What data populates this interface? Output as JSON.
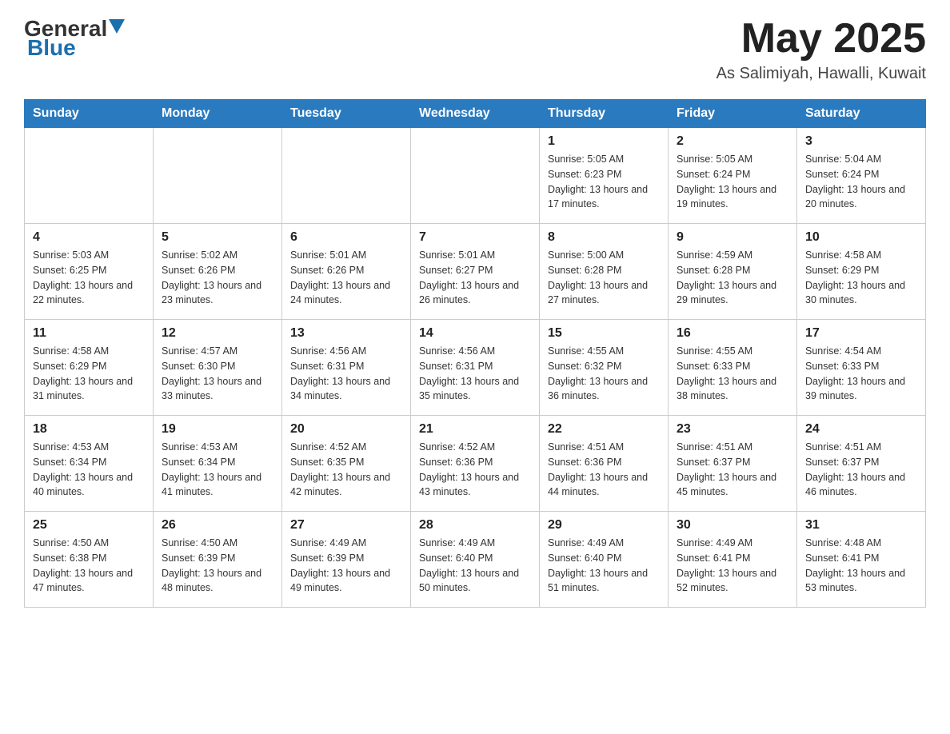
{
  "logo": {
    "general": "General",
    "blue": "Blue"
  },
  "title": {
    "month_year": "May 2025",
    "location": "As Salimiyah, Hawalli, Kuwait"
  },
  "headers": [
    "Sunday",
    "Monday",
    "Tuesday",
    "Wednesday",
    "Thursday",
    "Friday",
    "Saturday"
  ],
  "weeks": [
    [
      {
        "day": "",
        "info": ""
      },
      {
        "day": "",
        "info": ""
      },
      {
        "day": "",
        "info": ""
      },
      {
        "day": "",
        "info": ""
      },
      {
        "day": "1",
        "info": "Sunrise: 5:05 AM\nSunset: 6:23 PM\nDaylight: 13 hours and 17 minutes."
      },
      {
        "day": "2",
        "info": "Sunrise: 5:05 AM\nSunset: 6:24 PM\nDaylight: 13 hours and 19 minutes."
      },
      {
        "day": "3",
        "info": "Sunrise: 5:04 AM\nSunset: 6:24 PM\nDaylight: 13 hours and 20 minutes."
      }
    ],
    [
      {
        "day": "4",
        "info": "Sunrise: 5:03 AM\nSunset: 6:25 PM\nDaylight: 13 hours and 22 minutes."
      },
      {
        "day": "5",
        "info": "Sunrise: 5:02 AM\nSunset: 6:26 PM\nDaylight: 13 hours and 23 minutes."
      },
      {
        "day": "6",
        "info": "Sunrise: 5:01 AM\nSunset: 6:26 PM\nDaylight: 13 hours and 24 minutes."
      },
      {
        "day": "7",
        "info": "Sunrise: 5:01 AM\nSunset: 6:27 PM\nDaylight: 13 hours and 26 minutes."
      },
      {
        "day": "8",
        "info": "Sunrise: 5:00 AM\nSunset: 6:28 PM\nDaylight: 13 hours and 27 minutes."
      },
      {
        "day": "9",
        "info": "Sunrise: 4:59 AM\nSunset: 6:28 PM\nDaylight: 13 hours and 29 minutes."
      },
      {
        "day": "10",
        "info": "Sunrise: 4:58 AM\nSunset: 6:29 PM\nDaylight: 13 hours and 30 minutes."
      }
    ],
    [
      {
        "day": "11",
        "info": "Sunrise: 4:58 AM\nSunset: 6:29 PM\nDaylight: 13 hours and 31 minutes."
      },
      {
        "day": "12",
        "info": "Sunrise: 4:57 AM\nSunset: 6:30 PM\nDaylight: 13 hours and 33 minutes."
      },
      {
        "day": "13",
        "info": "Sunrise: 4:56 AM\nSunset: 6:31 PM\nDaylight: 13 hours and 34 minutes."
      },
      {
        "day": "14",
        "info": "Sunrise: 4:56 AM\nSunset: 6:31 PM\nDaylight: 13 hours and 35 minutes."
      },
      {
        "day": "15",
        "info": "Sunrise: 4:55 AM\nSunset: 6:32 PM\nDaylight: 13 hours and 36 minutes."
      },
      {
        "day": "16",
        "info": "Sunrise: 4:55 AM\nSunset: 6:33 PM\nDaylight: 13 hours and 38 minutes."
      },
      {
        "day": "17",
        "info": "Sunrise: 4:54 AM\nSunset: 6:33 PM\nDaylight: 13 hours and 39 minutes."
      }
    ],
    [
      {
        "day": "18",
        "info": "Sunrise: 4:53 AM\nSunset: 6:34 PM\nDaylight: 13 hours and 40 minutes."
      },
      {
        "day": "19",
        "info": "Sunrise: 4:53 AM\nSunset: 6:34 PM\nDaylight: 13 hours and 41 minutes."
      },
      {
        "day": "20",
        "info": "Sunrise: 4:52 AM\nSunset: 6:35 PM\nDaylight: 13 hours and 42 minutes."
      },
      {
        "day": "21",
        "info": "Sunrise: 4:52 AM\nSunset: 6:36 PM\nDaylight: 13 hours and 43 minutes."
      },
      {
        "day": "22",
        "info": "Sunrise: 4:51 AM\nSunset: 6:36 PM\nDaylight: 13 hours and 44 minutes."
      },
      {
        "day": "23",
        "info": "Sunrise: 4:51 AM\nSunset: 6:37 PM\nDaylight: 13 hours and 45 minutes."
      },
      {
        "day": "24",
        "info": "Sunrise: 4:51 AM\nSunset: 6:37 PM\nDaylight: 13 hours and 46 minutes."
      }
    ],
    [
      {
        "day": "25",
        "info": "Sunrise: 4:50 AM\nSunset: 6:38 PM\nDaylight: 13 hours and 47 minutes."
      },
      {
        "day": "26",
        "info": "Sunrise: 4:50 AM\nSunset: 6:39 PM\nDaylight: 13 hours and 48 minutes."
      },
      {
        "day": "27",
        "info": "Sunrise: 4:49 AM\nSunset: 6:39 PM\nDaylight: 13 hours and 49 minutes."
      },
      {
        "day": "28",
        "info": "Sunrise: 4:49 AM\nSunset: 6:40 PM\nDaylight: 13 hours and 50 minutes."
      },
      {
        "day": "29",
        "info": "Sunrise: 4:49 AM\nSunset: 6:40 PM\nDaylight: 13 hours and 51 minutes."
      },
      {
        "day": "30",
        "info": "Sunrise: 4:49 AM\nSunset: 6:41 PM\nDaylight: 13 hours and 52 minutes."
      },
      {
        "day": "31",
        "info": "Sunrise: 4:48 AM\nSunset: 6:41 PM\nDaylight: 13 hours and 53 minutes."
      }
    ]
  ]
}
